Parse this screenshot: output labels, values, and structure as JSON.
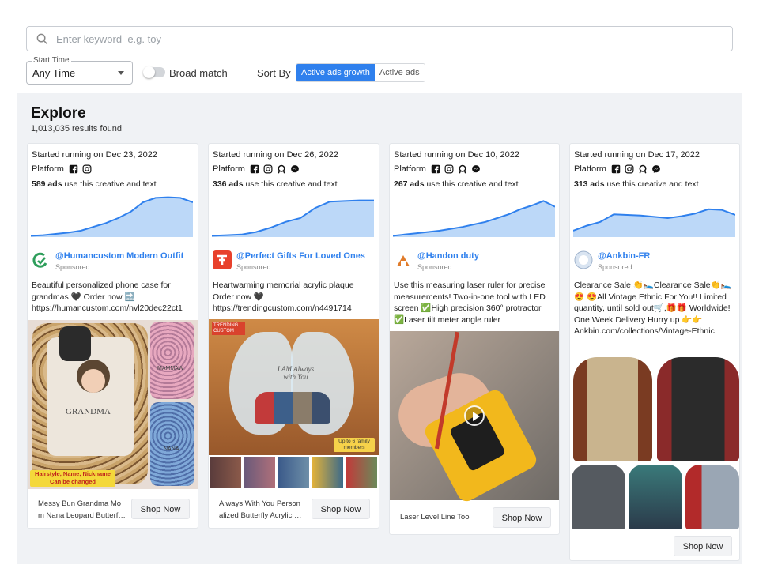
{
  "search": {
    "placeholder": "Enter keyword  e.g. toy",
    "value": ""
  },
  "filters": {
    "start_time_label": "Start Time",
    "start_time_value": "Any Time",
    "broad_match_label": "Broad match",
    "broad_match_on": false,
    "sort_by_label": "Sort By",
    "sort_options": [
      "Active ads growth",
      "Active ads"
    ],
    "sort_selected": "Active ads growth"
  },
  "explore": {
    "title": "Explore",
    "results": "1,013,035 results found"
  },
  "colors": {
    "accent": "#2f80ed",
    "chart_fill": "#bcd8f8",
    "chart_line": "#2f80ed"
  },
  "cards": [
    {
      "started": "Started running on Dec 23, 2022",
      "platform_label": "Platform",
      "platforms": [
        "facebook-icon",
        "instagram-icon"
      ],
      "ads_count": "589 ads",
      "ads_suffix": " use this creative and text",
      "trend": [
        2,
        3,
        5,
        7,
        10,
        16,
        22,
        30,
        40,
        55,
        62,
        63,
        62,
        55
      ],
      "advertiser": "@Humancustom Modern Outfit",
      "sponsored": "Sponsored",
      "description": "Beautiful personalized phone case for grandmas 🖤 Order now 🔜 https://humancustom.com/nvl20dec22ct1",
      "image_text": [
        "GRANDMA",
        "MAMMAW",
        "NANA",
        "Hairstyle, Name, Nickname",
        "Can be changed"
      ],
      "product": "Messy Bun Grandma Mo m Nana Leopard Butterf…",
      "button": "Shop Now"
    },
    {
      "started": "Started running on Dec 26, 2022",
      "platform_label": "Platform",
      "platforms": [
        "facebook-icon",
        "instagram-icon",
        "audience-network-icon",
        "messenger-icon"
      ],
      "ads_count": "336 ads",
      "ads_suffix": " use this creative and text",
      "trend": [
        2,
        3,
        4,
        8,
        15,
        24,
        30,
        46,
        56,
        57,
        58,
        58
      ],
      "advertiser": "@Perfect Gifts For Loved Ones",
      "sponsored": "Sponsored",
      "description": "Heartwarming memorial acrylic plaque Order now 🖤 https://trendingcustom.com/n4491714",
      "image_text": [
        "TRENDING CUSTOM",
        "I AM Always with You",
        "Up to 6 family members"
      ],
      "product": "Always With You Person alized Butterfly Acrylic …",
      "button": "Shop Now"
    },
    {
      "started": "Started running on Dec 10, 2022",
      "platform_label": "Platform",
      "platforms": [
        "facebook-icon",
        "instagram-icon",
        "audience-network-icon",
        "messenger-icon"
      ],
      "ads_count": "267 ads",
      "ads_suffix": " use this creative and text",
      "trend": [
        2,
        4,
        6,
        8,
        10,
        13,
        16,
        20,
        24,
        30,
        36,
        44,
        50,
        57,
        48
      ],
      "advertiser": "@Handon duty",
      "sponsored": "Sponsored",
      "description": "Use this measuring laser ruler for precise measurements! Two-in-one tool with LED screen ✅High precision 360° protractor ✅Laser tilt meter angle ruler",
      "product": "Laser Level Line Tool",
      "button": "Shop Now"
    },
    {
      "started": "Started running on Dec 17, 2022",
      "platform_label": "Platform",
      "platforms": [
        "facebook-icon",
        "instagram-icon",
        "audience-network-icon",
        "messenger-icon"
      ],
      "ads_count": "313 ads",
      "ads_suffix": " use this creative and text",
      "trend": [
        10,
        18,
        24,
        36,
        35,
        34,
        32,
        30,
        33,
        37,
        44,
        43,
        35
      ],
      "advertiser": "@Ankbin-FR",
      "sponsored": "Sponsored",
      "description": "Clearance Sale 👏🛌Clearance Sale👏🛌 😍 😍All Vintage Ethnic For You!! Limited quantity, until sold out🛒,🎁🎁 Worldwide! One Week Delivery Hurry up 👉👉 Ankbin.com/collections/Vintage-Ethnic",
      "button": "Shop Now"
    }
  ]
}
